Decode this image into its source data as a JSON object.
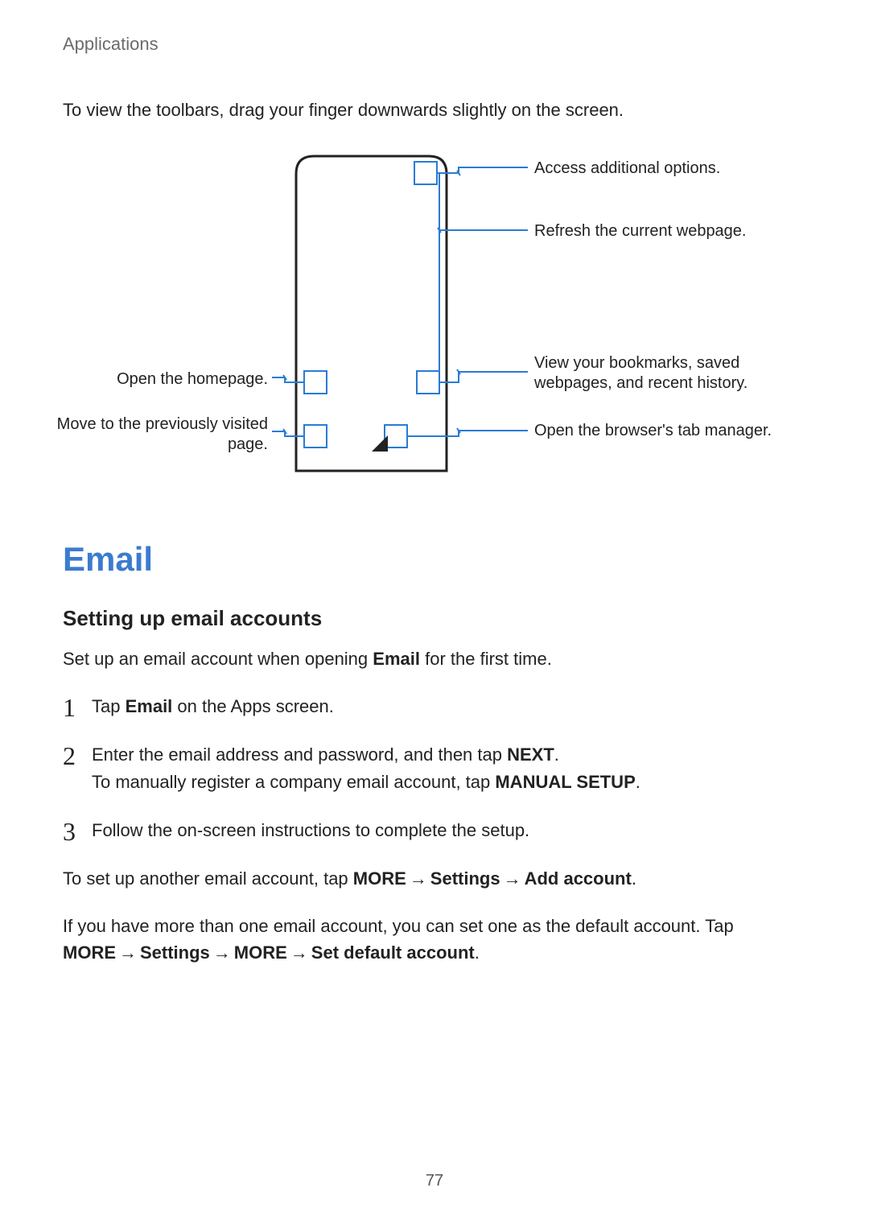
{
  "breadcrumb": "Applications",
  "intro": "To view the toolbars, drag your finger downwards slightly on the screen.",
  "diagram": {
    "callouts": {
      "options": "Access additional options.",
      "refresh": "Refresh the current webpage.",
      "bookmarks": "View your bookmarks, saved webpages, and recent history.",
      "tabs": "Open the browser's tab manager.",
      "home": "Open the homepage.",
      "back": "Move to the previously visited page."
    }
  },
  "section_title": "Email",
  "subsection_title": "Setting up email accounts",
  "setup_intro_a": "Set up an email account when opening ",
  "setup_intro_b": "Email",
  "setup_intro_c": " for the first time.",
  "steps": {
    "s1_a": "Tap ",
    "s1_b": "Email",
    "s1_c": " on the Apps screen.",
    "s2_a": "Enter the email address and password, and then tap ",
    "s2_b": "NEXT",
    "s2_c": ".",
    "s2_d": "To manually register a company email account, tap ",
    "s2_e": "MANUAL SETUP",
    "s2_f": ".",
    "s3": "Follow the on-screen instructions to complete the setup."
  },
  "after1_a": "To set up another email account, tap ",
  "after1_b": "MORE",
  "after1_c": "Settings",
  "after1_d": "Add account",
  "after1_e": ".",
  "after2_a": "If you have more than one email account, you can set one as the default account. Tap ",
  "after2_b": "MORE",
  "after2_c": "Settings",
  "after2_d": "MORE",
  "after2_e": "Set default account",
  "after2_f": ".",
  "arrow": "→",
  "page_number": "77"
}
